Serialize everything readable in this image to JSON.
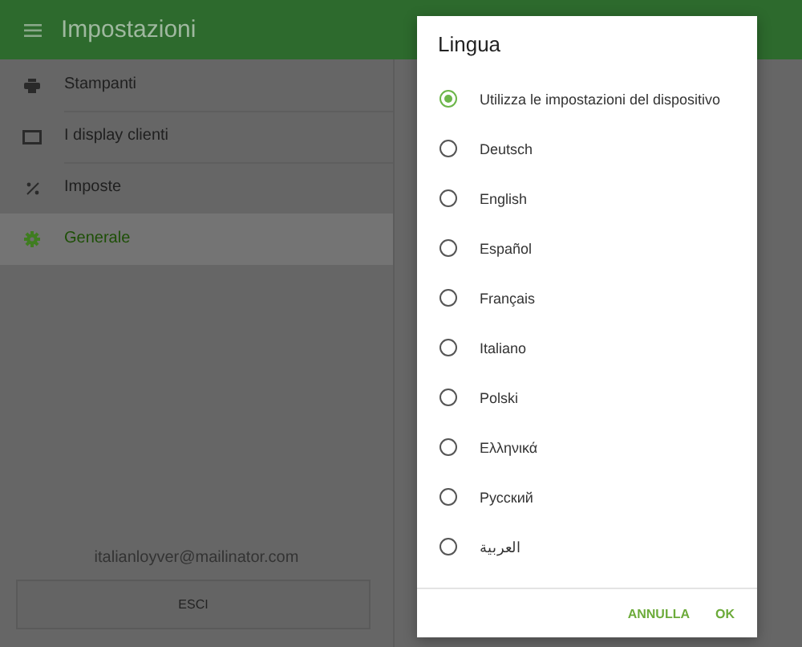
{
  "app_bar": {
    "title": "Impostazioni"
  },
  "sidebar": {
    "items": [
      {
        "label": "Stampanti",
        "kind": "printer",
        "selected": false
      },
      {
        "label": "I display clienti",
        "kind": "display",
        "selected": false
      },
      {
        "label": "Imposte",
        "kind": "percent",
        "selected": false
      },
      {
        "label": "Generale",
        "kind": "gear",
        "selected": true
      }
    ],
    "account_email": "italianloyver@mailinator.com",
    "logout_button": "ESCI"
  },
  "dialog": {
    "title": "Lingua",
    "options": [
      {
        "label": "Utilizza le impostazioni del dispositivo",
        "selected": true
      },
      {
        "label": "Deutsch",
        "selected": false
      },
      {
        "label": "English",
        "selected": false
      },
      {
        "label": "Español",
        "selected": false
      },
      {
        "label": "Français",
        "selected": false
      },
      {
        "label": "Italiano",
        "selected": false
      },
      {
        "label": "Polski",
        "selected": false
      },
      {
        "label": "Ελληνικά",
        "selected": false
      },
      {
        "label": "Русский",
        "selected": false
      },
      {
        "label": "العربية",
        "selected": false
      }
    ],
    "buttons": [
      "ANNULLA",
      "OK"
    ]
  }
}
